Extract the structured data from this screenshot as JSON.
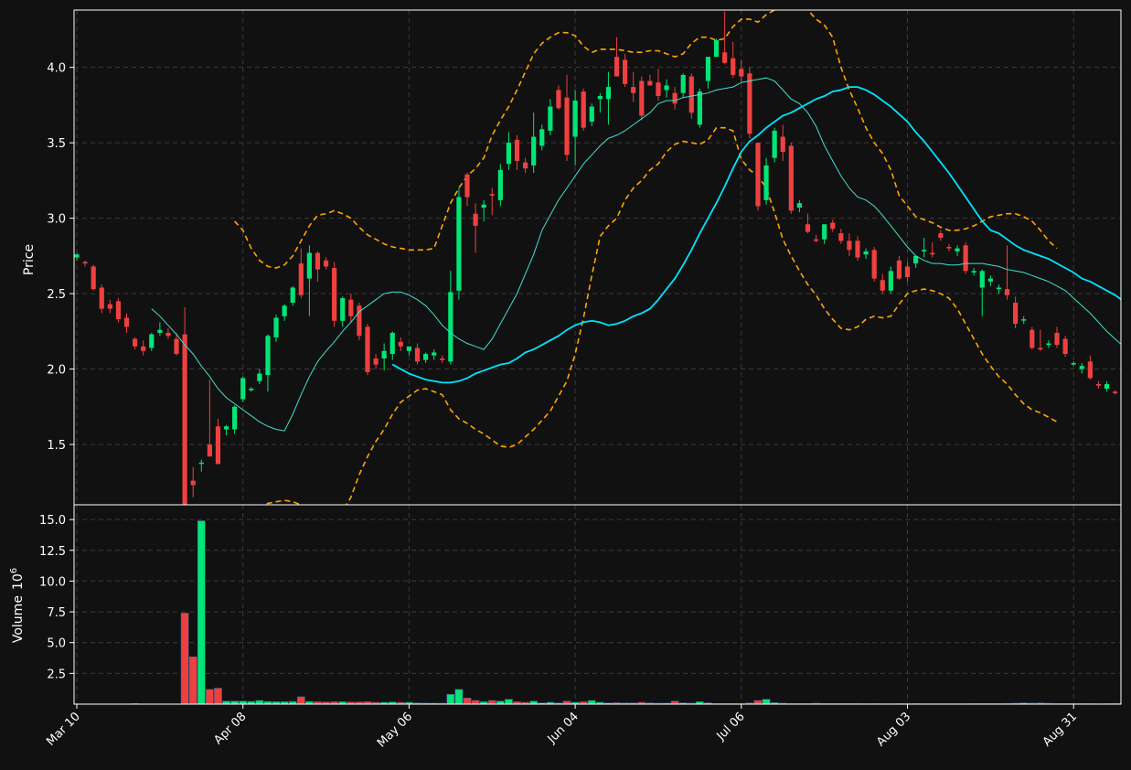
{
  "chart_data": [
    {
      "type": "candlestick",
      "panel": "price",
      "ylabel": "Price",
      "ylim": [
        1.1,
        4.38
      ],
      "y_ticks": [
        "1.5",
        "2.0",
        "2.5",
        "3.0",
        "3.5",
        "4.0"
      ],
      "grid": true,
      "x_tick_labels": [
        "Mar 10",
        "Apr 08",
        "May 06",
        "Jun 04",
        "Jul 06",
        "Aug 03",
        "Aug 31"
      ],
      "x_tick_indices": [
        0,
        20,
        40,
        60,
        80,
        100,
        120
      ],
      "colors": {
        "up": "#00e676",
        "down": "#ef4040",
        "ma_fast": "#40e0d0",
        "ma_slow": "#00e5ff",
        "bands": "#ffa500",
        "background": "#111111",
        "grid": "#3a3a3a"
      },
      "candles": [
        [
          2.74,
          2.77,
          2.72,
          2.76
        ],
        [
          2.71,
          2.72,
          2.68,
          2.7
        ],
        [
          2.68,
          2.69,
          2.52,
          2.53
        ],
        [
          2.54,
          2.56,
          2.37,
          2.4
        ],
        [
          2.43,
          2.46,
          2.37,
          2.4
        ],
        [
          2.45,
          2.47,
          2.31,
          2.33
        ],
        [
          2.34,
          2.37,
          2.24,
          2.28
        ],
        [
          2.2,
          2.21,
          2.13,
          2.15
        ],
        [
          2.15,
          2.19,
          2.09,
          2.12
        ],
        [
          2.14,
          2.24,
          2.12,
          2.23
        ],
        [
          2.24,
          2.31,
          2.22,
          2.26
        ],
        [
          2.24,
          2.27,
          2.2,
          2.22
        ],
        [
          2.2,
          2.24,
          2.09,
          2.1
        ],
        [
          2.23,
          2.41,
          1.1,
          1.1
        ],
        [
          1.26,
          1.35,
          1.15,
          1.23
        ],
        [
          1.38,
          1.4,
          1.32,
          1.38
        ],
        [
          1.5,
          1.93,
          1.44,
          1.42
        ],
        [
          1.62,
          1.67,
          1.38,
          1.37
        ],
        [
          1.6,
          1.63,
          1.56,
          1.62
        ],
        [
          1.6,
          1.76,
          1.57,
          1.75
        ],
        [
          1.8,
          1.95,
          1.78,
          1.94
        ],
        [
          1.86,
          1.88,
          1.85,
          1.87
        ],
        [
          1.92,
          2.0,
          1.9,
          1.97
        ],
        [
          1.96,
          2.23,
          1.85,
          2.22
        ],
        [
          2.21,
          2.36,
          2.18,
          2.34
        ],
        [
          2.35,
          2.43,
          2.32,
          2.42
        ],
        [
          2.44,
          2.55,
          2.42,
          2.54
        ],
        [
          2.7,
          2.8,
          2.47,
          2.49
        ],
        [
          2.6,
          2.82,
          2.35,
          2.77
        ],
        [
          2.77,
          2.78,
          2.58,
          2.66
        ],
        [
          2.72,
          2.74,
          2.66,
          2.68
        ],
        [
          2.67,
          2.71,
          2.28,
          2.32
        ],
        [
          2.32,
          2.48,
          2.28,
          2.47
        ],
        [
          2.46,
          2.5,
          2.31,
          2.35
        ],
        [
          2.42,
          2.44,
          2.19,
          2.22
        ],
        [
          2.28,
          2.3,
          1.96,
          1.98
        ],
        [
          2.07,
          2.1,
          2.0,
          2.03
        ],
        [
          2.07,
          2.17,
          1.99,
          2.12
        ],
        [
          2.1,
          2.25,
          2.06,
          2.24
        ],
        [
          2.18,
          2.21,
          2.12,
          2.15
        ],
        [
          2.12,
          2.14,
          2.09,
          2.15
        ],
        [
          2.14,
          2.17,
          2.03,
          2.05
        ],
        [
          2.06,
          2.11,
          2.04,
          2.1
        ],
        [
          2.09,
          2.13,
          2.06,
          2.11
        ],
        [
          2.07,
          2.09,
          2.04,
          2.06
        ],
        [
          2.05,
          2.65,
          2.03,
          2.51
        ],
        [
          2.52,
          3.2,
          2.46,
          3.14
        ],
        [
          3.29,
          3.3,
          3.08,
          3.14
        ],
        [
          3.03,
          3.1,
          2.77,
          2.95
        ],
        [
          3.07,
          3.12,
          2.98,
          3.09
        ],
        [
          3.16,
          3.2,
          3.02,
          3.15
        ],
        [
          3.12,
          3.36,
          3.08,
          3.32
        ],
        [
          3.36,
          3.57,
          3.32,
          3.5
        ],
        [
          3.52,
          3.55,
          3.32,
          3.38
        ],
        [
          3.37,
          3.4,
          3.3,
          3.33
        ],
        [
          3.35,
          3.7,
          3.3,
          3.54
        ],
        [
          3.48,
          3.62,
          3.45,
          3.59
        ],
        [
          3.58,
          3.79,
          3.55,
          3.74
        ],
        [
          3.85,
          3.88,
          3.72,
          3.73
        ],
        [
          3.8,
          3.95,
          3.38,
          3.42
        ],
        [
          3.54,
          3.85,
          3.35,
          3.78
        ],
        [
          3.84,
          3.86,
          3.58,
          3.6
        ],
        [
          3.64,
          3.76,
          3.61,
          3.74
        ],
        [
          3.79,
          3.83,
          3.7,
          3.81
        ],
        [
          3.79,
          3.97,
          3.62,
          3.87
        ],
        [
          4.07,
          4.2,
          3.96,
          3.94
        ],
        [
          4.05,
          4.09,
          3.87,
          3.89
        ],
        [
          3.87,
          3.97,
          3.77,
          3.83
        ],
        [
          3.91,
          3.94,
          3.65,
          3.68
        ],
        [
          3.91,
          3.95,
          3.88,
          3.88
        ],
        [
          3.9,
          3.99,
          3.78,
          3.81
        ],
        [
          3.85,
          3.92,
          3.8,
          3.88
        ],
        [
          3.83,
          3.87,
          3.72,
          3.76
        ],
        [
          3.83,
          3.96,
          3.8,
          3.95
        ],
        [
          3.94,
          3.96,
          3.66,
          3.7
        ],
        [
          3.62,
          3.86,
          3.6,
          3.84
        ],
        [
          3.91,
          4.05,
          3.86,
          4.07
        ],
        [
          4.07,
          4.19,
          4.07,
          4.18
        ],
        [
          4.1,
          4.37,
          4.02,
          4.03
        ],
        [
          4.06,
          4.17,
          3.93,
          3.95
        ],
        [
          3.99,
          4.05,
          3.9,
          3.94
        ],
        [
          3.96,
          4.0,
          3.53,
          3.56
        ],
        [
          3.5,
          3.5,
          3.05,
          3.08
        ],
        [
          3.12,
          3.4,
          3.09,
          3.35
        ],
        [
          3.4,
          3.6,
          3.37,
          3.58
        ],
        [
          3.54,
          3.62,
          3.38,
          3.44
        ],
        [
          3.48,
          3.5,
          3.03,
          3.05
        ],
        [
          3.07,
          3.12,
          3.04,
          3.1
        ],
        [
          2.96,
          3.03,
          2.9,
          2.91
        ],
        [
          2.86,
          2.89,
          2.84,
          2.85
        ],
        [
          2.86,
          2.93,
          2.83,
          2.96
        ],
        [
          2.97,
          2.99,
          2.91,
          2.93
        ],
        [
          2.9,
          2.93,
          2.83,
          2.85
        ],
        [
          2.85,
          2.9,
          2.75,
          2.79
        ],
        [
          2.85,
          2.88,
          2.72,
          2.74
        ],
        [
          2.76,
          2.8,
          2.73,
          2.78
        ],
        [
          2.79,
          2.81,
          2.58,
          2.6
        ],
        [
          2.59,
          2.63,
          2.5,
          2.52
        ],
        [
          2.52,
          2.68,
          2.5,
          2.65
        ],
        [
          2.72,
          2.75,
          2.59,
          2.6
        ],
        [
          2.68,
          2.71,
          2.58,
          2.61
        ],
        [
          2.7,
          2.74,
          2.67,
          2.75
        ],
        [
          2.78,
          2.87,
          2.74,
          2.79
        ],
        [
          2.77,
          2.84,
          2.74,
          2.76
        ],
        [
          2.9,
          2.92,
          2.85,
          2.87
        ],
        [
          2.81,
          2.83,
          2.78,
          2.8
        ],
        [
          2.78,
          2.82,
          2.75,
          2.8
        ],
        [
          2.82,
          2.84,
          2.63,
          2.65
        ],
        [
          2.64,
          2.67,
          2.62,
          2.65
        ],
        [
          2.54,
          2.66,
          2.35,
          2.65
        ],
        [
          2.58,
          2.62,
          2.55,
          2.6
        ],
        [
          2.53,
          2.56,
          2.5,
          2.54
        ],
        [
          2.53,
          2.82,
          2.46,
          2.49
        ],
        [
          2.44,
          2.48,
          2.27,
          2.3
        ],
        [
          2.33,
          2.35,
          2.3,
          2.33
        ],
        [
          2.26,
          2.28,
          2.13,
          2.14
        ],
        [
          2.14,
          2.26,
          2.12,
          2.13
        ],
        [
          2.16,
          2.19,
          2.14,
          2.17
        ],
        [
          2.24,
          2.28,
          2.14,
          2.16
        ],
        [
          2.2,
          2.22,
          2.08,
          2.1
        ],
        [
          2.03,
          2.05,
          2.02,
          2.04
        ],
        [
          2.0,
          2.04,
          1.97,
          2.02
        ],
        [
          2.05,
          2.09,
          1.93,
          1.94
        ],
        [
          1.9,
          1.92,
          1.87,
          1.89
        ],
        [
          1.87,
          1.92,
          1.85,
          1.9
        ],
        [
          1.85,
          1.86,
          1.83,
          1.84
        ],
        [
          1.83,
          1.86,
          1.79,
          1.8
        ]
      ],
      "ma_fast": [
        null,
        null,
        null,
        null,
        null,
        null,
        null,
        null,
        null,
        2.4,
        2.35,
        2.29,
        2.23,
        2.16,
        2.1,
        2.02,
        1.95,
        1.87,
        1.81,
        1.77,
        1.73,
        1.69,
        1.65,
        1.62,
        1.6,
        1.59,
        1.7,
        1.83,
        1.95,
        2.05,
        2.12,
        2.18,
        2.25,
        2.31,
        2.38,
        2.42,
        2.46,
        2.5,
        2.51,
        2.51,
        2.49,
        2.46,
        2.42,
        2.36,
        2.29,
        2.24,
        2.2,
        2.17,
        2.15,
        2.13,
        2.2,
        2.3,
        2.4,
        2.5,
        2.63,
        2.76,
        2.92,
        3.02,
        3.12,
        3.2,
        3.28,
        3.36,
        3.42,
        3.48,
        3.53,
        3.55,
        3.58,
        3.62,
        3.66,
        3.7,
        3.76,
        3.78,
        3.78,
        3.8,
        3.81,
        3.82,
        3.83,
        3.85,
        3.86,
        3.87,
        3.9,
        3.91,
        3.92,
        3.93,
        3.91,
        3.85,
        3.79,
        3.76,
        3.7,
        3.61,
        3.48,
        3.38,
        3.28,
        3.2,
        3.14,
        3.12,
        3.08,
        3.02,
        2.95,
        2.88,
        2.81,
        2.75,
        2.72,
        2.7,
        2.7,
        2.69,
        2.69,
        2.7,
        2.7,
        2.7,
        2.69,
        2.68,
        2.66,
        2.65,
        2.64,
        2.62,
        2.6,
        2.58,
        2.55,
        2.52,
        2.47,
        2.42,
        2.37,
        2.31,
        2.25,
        2.2,
        2.15,
        2.11,
        2.07,
        2.03,
        1.99,
        1.97
      ],
      "ma_slow": [
        null,
        null,
        null,
        null,
        null,
        null,
        null,
        null,
        null,
        null,
        null,
        null,
        null,
        null,
        null,
        null,
        null,
        null,
        null,
        2.03,
        2.0,
        1.97,
        1.95,
        1.93,
        1.92,
        1.91,
        1.91,
        1.92,
        1.94,
        1.97,
        1.99,
        2.01,
        2.03,
        2.04,
        2.07,
        2.11,
        2.13,
        2.16,
        2.19,
        2.22,
        2.26,
        2.29,
        2.31,
        2.32,
        2.31,
        2.29,
        2.3,
        2.32,
        2.35,
        2.37,
        2.4,
        2.46,
        2.53,
        2.6,
        2.69,
        2.79,
        2.9,
        3.0,
        3.1,
        3.21,
        3.33,
        3.44,
        3.51,
        3.55,
        3.6,
        3.64,
        3.68,
        3.7,
        3.73,
        3.76,
        3.79,
        3.81,
        3.84,
        3.85,
        3.87,
        3.87,
        3.85,
        3.82,
        3.78,
        3.74,
        3.69,
        3.64,
        3.57,
        3.51,
        3.44,
        3.37,
        3.3,
        3.22,
        3.14,
        3.06,
        2.98,
        2.92,
        2.9,
        2.86,
        2.82,
        2.79,
        2.77,
        2.75,
        2.73,
        2.7,
        2.67,
        2.64,
        2.6,
        2.58,
        2.55,
        2.52,
        2.49,
        2.45,
        2.4,
        2.35,
        2.29,
        2.23
      ],
      "ma_slow_start_index": 19,
      "band_upper": [
        2.98,
        2.92,
        2.8,
        2.72,
        2.68,
        2.67,
        2.69,
        2.75,
        2.85,
        2.95,
        3.02,
        3.03,
        3.05,
        3.03,
        3.0,
        2.94,
        2.89,
        2.86,
        2.83,
        2.81,
        2.8,
        2.79,
        2.79,
        2.79,
        2.8,
        2.95,
        3.1,
        3.2,
        3.28,
        3.33,
        3.4,
        3.55,
        3.65,
        3.74,
        3.85,
        3.97,
        4.09,
        4.16,
        4.2,
        4.23,
        4.23,
        4.21,
        4.14,
        4.1,
        4.12,
        4.12,
        4.12,
        4.11,
        4.1,
        4.1,
        4.11,
        4.11,
        4.09,
        4.07,
        4.09,
        4.16,
        4.2,
        4.2,
        4.18,
        4.19,
        4.27,
        4.32,
        4.32,
        4.3,
        4.35,
        4.38,
        4.44,
        4.48,
        4.45,
        4.38,
        4.32,
        4.28,
        4.2,
        4.0,
        3.85,
        3.73,
        3.6,
        3.5,
        3.43,
        3.32,
        3.15,
        3.08,
        3.01,
        2.99,
        2.97,
        2.94,
        2.92,
        2.92,
        2.93,
        2.95,
        2.98,
        3.01,
        3.02,
        3.03,
        3.03,
        3.01,
        2.98,
        2.92,
        2.85,
        2.8
      ],
      "band_upper_start_index": 19,
      "band_lower": [
        1.0,
        1.05,
        1.07,
        1.09,
        1.11,
        1.12,
        1.13,
        1.12,
        1.1,
        1.08,
        1.03,
        1.0,
        0.98,
        1.06,
        1.15,
        1.3,
        1.42,
        1.52,
        1.6,
        1.7,
        1.78,
        1.82,
        1.86,
        1.87,
        1.85,
        1.83,
        1.73,
        1.67,
        1.64,
        1.6,
        1.57,
        1.53,
        1.49,
        1.48,
        1.5,
        1.55,
        1.6,
        1.66,
        1.72,
        1.82,
        1.92,
        2.1,
        2.34,
        2.62,
        2.88,
        2.95,
        3.0,
        3.12,
        3.2,
        3.25,
        3.32,
        3.36,
        3.44,
        3.49,
        3.51,
        3.5,
        3.49,
        3.52,
        3.6,
        3.6,
        3.58,
        3.39,
        3.32,
        3.28,
        3.2,
        3.04,
        2.86,
        2.75,
        2.65,
        2.56,
        2.49,
        2.4,
        2.33,
        2.27,
        2.26,
        2.28,
        2.33,
        2.35,
        2.34,
        2.35,
        2.43,
        2.5,
        2.52,
        2.53,
        2.52,
        2.5,
        2.47,
        2.4,
        2.3,
        2.2,
        2.1,
        2.02,
        1.95,
        1.9,
        1.83,
        1.77,
        1.73,
        1.71,
        1.68,
        1.65
      ],
      "band_lower_start_index": 19
    },
    {
      "type": "bar",
      "panel": "volume",
      "ylabel": "Volume",
      "ylabel_exponent": "10",
      "ylabel_exponent_power": "6",
      "ylim": [
        0,
        16.2
      ],
      "y_ticks": [
        "2.5",
        "5.0",
        "7.5",
        "10.0",
        "12.5",
        "15.0"
      ],
      "grid": true,
      "volumes": [
        0.02,
        0.02,
        0.02,
        0.02,
        0.02,
        0.02,
        0.02,
        0.05,
        0.02,
        0.02,
        0.02,
        0.02,
        0.02,
        7.4,
        3.85,
        14.9,
        1.2,
        1.3,
        0.25,
        0.25,
        0.25,
        0.22,
        0.3,
        0.22,
        0.2,
        0.2,
        0.22,
        0.6,
        0.22,
        0.2,
        0.18,
        0.2,
        0.2,
        0.18,
        0.18,
        0.2,
        0.15,
        0.15,
        0.18,
        0.15,
        0.15,
        0.1,
        0.08,
        0.08,
        0.08,
        0.8,
        1.2,
        0.5,
        0.3,
        0.2,
        0.3,
        0.25,
        0.4,
        0.2,
        0.15,
        0.25,
        0.1,
        0.15,
        0.1,
        0.25,
        0.15,
        0.2,
        0.3,
        0.15,
        0.1,
        0.12,
        0.1,
        0.1,
        0.15,
        0.1,
        0.08,
        0.08,
        0.25,
        0.1,
        0.08,
        0.2,
        0.1,
        0.05,
        0.05,
        0.05,
        0.05,
        0.1,
        0.3,
        0.4,
        0.12,
        0.08,
        0.05,
        0.05,
        0.05,
        0.08,
        0.05,
        0.05,
        0.05,
        0.05,
        0.05,
        0.04,
        0.05,
        0.04,
        0.04,
        0.05,
        0.04,
        0.05,
        0.04,
        0.04,
        0.04,
        0.04,
        0.04,
        0.04,
        0.05,
        0.05,
        0.05,
        0.05,
        0.06,
        0.08,
        0.1,
        0.08,
        0.1,
        0.07,
        0.05,
        0.05,
        0.05,
        0.05,
        0.05,
        0.04,
        0.05,
        0.06,
        0.08,
        0.15,
        0.1,
        0.15,
        0.05,
        0.2
      ]
    }
  ]
}
